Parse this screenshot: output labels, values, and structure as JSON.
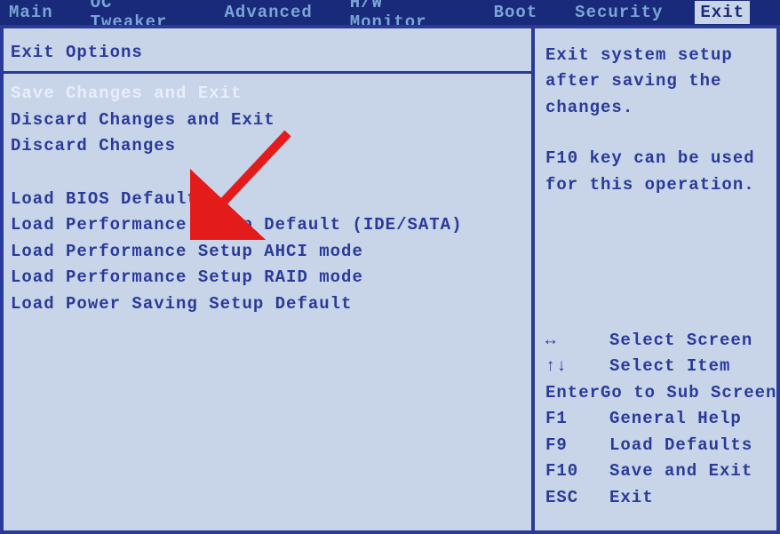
{
  "menubar": {
    "items": [
      {
        "label": "Main",
        "active": false
      },
      {
        "label": "OC Tweaker",
        "active": false
      },
      {
        "label": "Advanced",
        "active": false
      },
      {
        "label": "H/W Monitor",
        "active": false
      },
      {
        "label": "Boot",
        "active": false
      },
      {
        "label": "Security",
        "active": false
      },
      {
        "label": "Exit",
        "active": true
      }
    ]
  },
  "left": {
    "section_title": "Exit Options",
    "group1": [
      {
        "label": "Save Changes and Exit",
        "selected": true
      },
      {
        "label": "Discard Changes and Exit",
        "selected": false
      },
      {
        "label": "Discard Changes",
        "selected": false
      }
    ],
    "group2": [
      {
        "label": "Load BIOS Defaults",
        "selected": false
      },
      {
        "label": "Load Performance Setup Default (IDE/SATA)",
        "selected": false
      },
      {
        "label": "Load Performance Setup AHCI mode",
        "selected": false
      },
      {
        "label": "Load Performance Setup RAID mode",
        "selected": false
      },
      {
        "label": "Load Power Saving Setup Default",
        "selected": false
      }
    ]
  },
  "right": {
    "help_line1": "Exit system setup",
    "help_line2": "after saving the",
    "help_line3": "changes.",
    "help_line4": "F10 key can be used",
    "help_line5": "for this operation.",
    "keys": [
      {
        "key": "↔",
        "desc": "Select Screen"
      },
      {
        "key": "↑↓",
        "desc": "Select Item"
      },
      {
        "key": "Enter",
        "desc": "Go to Sub Screen"
      },
      {
        "key": "F1",
        "desc": "General Help"
      },
      {
        "key": "F9",
        "desc": "Load Defaults"
      },
      {
        "key": "F10",
        "desc": "Save and Exit"
      },
      {
        "key": "ESC",
        "desc": "Exit"
      }
    ]
  }
}
